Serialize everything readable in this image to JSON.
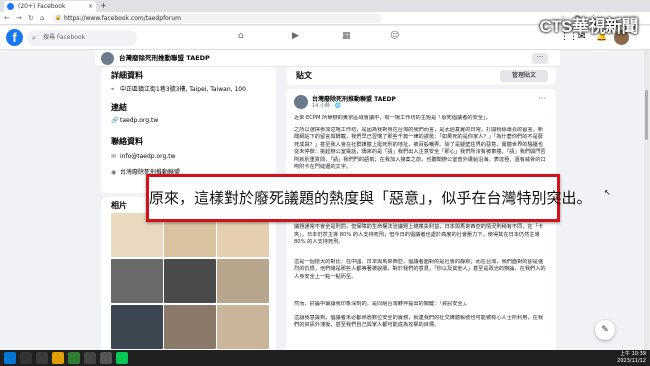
{
  "browser": {
    "tab_title": "(20+) Facebook",
    "tab_close": "×",
    "new_tab": "+",
    "url": "https://www.facebook.com/taedpforum"
  },
  "fb": {
    "logo": "f",
    "search_placeholder": "搜尋 Facebook"
  },
  "page": {
    "name": "台灣廢除死刑推動聯盟 TAEDP",
    "more": "···"
  },
  "about": {
    "details_heading": "詳細資料",
    "address": "中正區鎮江街1巷3號3樓, Taipei, Taiwan, 100",
    "links_heading": "連結",
    "website": "taedp.org.tw",
    "contact_heading": "聯絡資料",
    "email": "info@taedp.org.tw",
    "phone_partial": "台灣廢除死刑推動聯盟",
    "photos_heading": "相片"
  },
  "feed": {
    "section_label": "貼文",
    "manage_button": "管理貼文",
    "author": "台灣廢除死刑推動聯盟 TAEDP",
    "meta": "14 小時 · 🌐",
    "dots": "···",
    "p1": "近來 ECPM 所舉辦的東京區域會議中，有一場工作坊的主題是「廢死倡議者的安全」。",
    "p2": "之所以選擇參加這場工作坊，是因為我對身在台灣的我們而言，是太過真實的日常。打開粉絲專頁的留言，新聞網站下的留言與轉載，我們早已習慣了那些千篇一律的謾罵：「如果死的是你家人？」「為什麼你們的不是廢死成員？」甚至我人會在社群媒體上挺死刑的地址，被百般嘲弄。除了是疑壁往界的惡意，實體世界的騷擾也從未停歇：挑起辦公室電話，傳來的是「請」我們出入注意安全「那心」我們所沒有被車撞，「請」我們開門否則就別重質問，「請」我們門的語氣；在我加入接案之前，也聽聞辦公室曾外遭給沿海，表達極、還有威脅的口吻附卡在門縫邊的文字。",
    "p3": "中國的事件分享，排除涉及特殊的敏感組織；否則一般非政府組織其實並不會意識，而在他們的環境裡，廢死議題通常不會全是刑罰，但保障的生命權法治議題上總喪失利益，日本與馬來西亞的情況則稍有不同，在「卡夾」，日本仍然主導 80% 的人支持死刑；但今日的倡議者也處於高度的社會壓力下，使得其在日本仍然主導 80% 的人支持死刑。",
    "p4": "這是一個很大的對比：在中國、日本與馬來西亞，倡議者面對的是社會的靜默；而在台灣，我們面對的卻是強烈的仇恨，他們總是那些人都等著被說服，對於我們的意見，「你以及其他人」甚至是政治的辯論，在我們人的人身安全上一點一點而至。",
    "p5": "然而，討論中最讓我印象深刻的，是同組台灣夥伴提出的關鍵：「資訊安全」。",
    "p6": "這讓我意識到，倡議者未必都熟悉數位安全的實務，就連我們的社交媒體帳號也可能被有心人士所利用，在我們的資訊外洩後，甚至我們自己與家人都可能成為攻擊的目標。"
  },
  "caption": {
    "text": "原來，這樣對於廢死議題的熱度與「惡意」，似乎在台灣特別突出。"
  },
  "watermark": {
    "text": "CTS華視新聞"
  },
  "taskbar": {
    "time": "上午 10:39",
    "date": "2023/11/12"
  }
}
